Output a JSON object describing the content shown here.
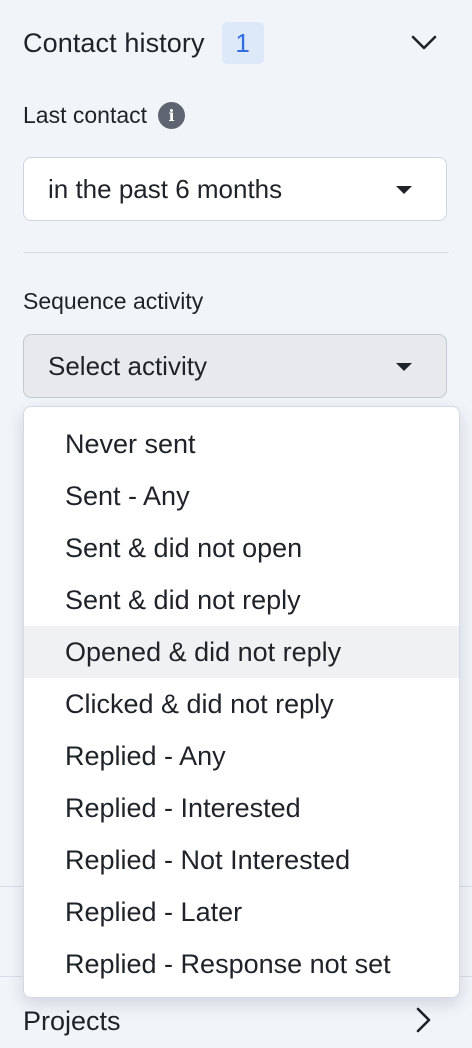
{
  "contact_history": {
    "title": "Contact history",
    "count": "1",
    "collapse_icon": "chevron-down-icon"
  },
  "last_contact": {
    "label": "Last contact",
    "info_icon": "info-icon",
    "info_glyph": "i",
    "selected_value": "in the past 6 months"
  },
  "sequence_activity": {
    "label": "Sequence activity",
    "placeholder": "Select activity",
    "highlighted_index": 4,
    "options": [
      "Never sent",
      "Sent - Any",
      "Sent & did not open",
      "Sent & did not reply",
      "Opened & did not reply",
      "Clicked & did not reply",
      "Replied - Any",
      "Replied - Interested",
      "Replied - Not Interested",
      "Replied - Later",
      "Replied - Response not set"
    ]
  },
  "projects": {
    "label": "Projects",
    "expand_icon": "chevron-right-icon"
  },
  "colors": {
    "panel_background": "#f1f4f9",
    "badge_background": "#dde8f8",
    "badge_text": "#2f6fe0",
    "highlight_row": "#f0f1f3"
  }
}
